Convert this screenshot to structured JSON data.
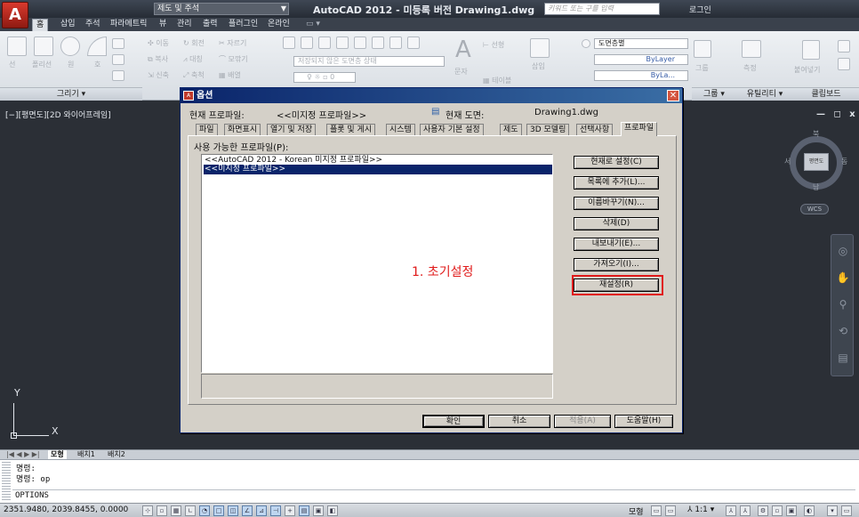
{
  "titlebar": {
    "logo_letter": "A",
    "workspace": "제도 및 주석",
    "app_title": "AutoCAD 2012 - 미등록 버전    Drawing1.dwg",
    "search_placeholder": "키워드 또는 구를 입력",
    "login_label": "로그인",
    "window_controls": "— ☐ ✕"
  },
  "ribbon": {
    "tabs": [
      "홈",
      "삽입",
      "주석",
      "파라메트릭",
      "뷰",
      "관리",
      "출력",
      "플러그인",
      "온라인"
    ],
    "draw_tools": [
      "선",
      "폴리선",
      "원",
      "호"
    ],
    "modify_tools": [
      "이동",
      "회전",
      "자르기",
      "복사",
      "대칭",
      "모깎기",
      "신축",
      "축척",
      "배열"
    ],
    "layer_state": "저장되지 않은 도면층 상태",
    "layer_name": "도면층별",
    "bylayer_1": "ByLayer",
    "bylayer_2": "ByLa...",
    "text_label": "문자",
    "dimension_label": "선형",
    "table_label": "테이블",
    "insert_label": "삽입",
    "group_label": "그룹",
    "measure_label": "측정",
    "paste_label": "붙여넣기",
    "panels": [
      "그리기 ▾",
      "그룹 ▾",
      "유틸리티 ▾",
      "클립보드"
    ]
  },
  "drawing": {
    "view_label": "[−][평면도][2D 와이어프레임]",
    "win_controls": "— ◻ x",
    "compass": {
      "n": "북",
      "s": "남",
      "e": "동",
      "w": "서"
    },
    "viewcube_top": "평면도",
    "wcs": "WCS",
    "ucs_x": "X",
    "ucs_y": "Y"
  },
  "layout_tabs": [
    "모형",
    "배치1",
    "배치2"
  ],
  "command": {
    "history": [
      "명령:",
      "명령: op"
    ],
    "current": "OPTIONS"
  },
  "statusbar": {
    "coords": "2351.9480, 2039.8455, 0.0000",
    "model": "모형",
    "scale": "1:1 ▾"
  },
  "dialog": {
    "title": "옵션",
    "close": "✕",
    "current_profile_label": "현재 프로파일:",
    "current_profile_value": "<<미지정 프로파일>>",
    "current_drawing_label": "현재 도면:",
    "current_drawing_value": "Drawing1.dwg",
    "tabs": [
      "파일",
      "화면표시",
      "열기 및 저장",
      "플롯 및 게시",
      "시스템",
      "사용자 기본 설정",
      "제도",
      "3D 모델링",
      "선택사항",
      "프로파일"
    ],
    "available_profiles_label": "사용 가능한 프로파일(P):",
    "profiles": [
      "<<AutoCAD 2012 - Korean 미지정 프로파일>>",
      "<<미지정 프로파일>>"
    ],
    "buttons": {
      "set_current": "현재로 설정(C)",
      "add_to_list": "목록에 추가(L)...",
      "rename": "이름바꾸기(N)...",
      "delete": "삭제(D)",
      "export": "내보내기(E)...",
      "import": "가져오기(I)...",
      "reset": "재설정(R)"
    },
    "annotation": "1. 초기설정",
    "footer": {
      "ok": "확인",
      "cancel": "취소",
      "apply": "적용(A)",
      "help": "도움말(H)"
    }
  }
}
